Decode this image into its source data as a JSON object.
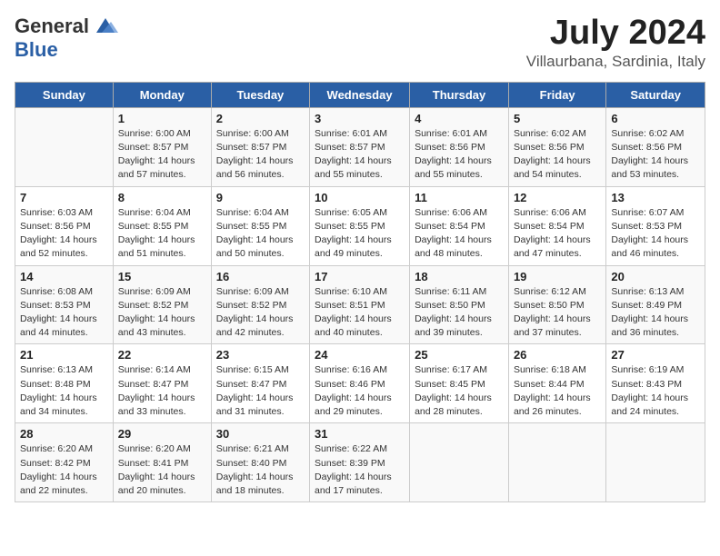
{
  "logo": {
    "general": "General",
    "blue": "Blue"
  },
  "title": "July 2024",
  "subtitle": "Villaurbana, Sardinia, Italy",
  "days_of_week": [
    "Sunday",
    "Monday",
    "Tuesday",
    "Wednesday",
    "Thursday",
    "Friday",
    "Saturday"
  ],
  "weeks": [
    [
      {
        "day": "",
        "info": ""
      },
      {
        "day": "1",
        "info": "Sunrise: 6:00 AM\nSunset: 8:57 PM\nDaylight: 14 hours\nand 57 minutes."
      },
      {
        "day": "2",
        "info": "Sunrise: 6:00 AM\nSunset: 8:57 PM\nDaylight: 14 hours\nand 56 minutes."
      },
      {
        "day": "3",
        "info": "Sunrise: 6:01 AM\nSunset: 8:57 PM\nDaylight: 14 hours\nand 55 minutes."
      },
      {
        "day": "4",
        "info": "Sunrise: 6:01 AM\nSunset: 8:56 PM\nDaylight: 14 hours\nand 55 minutes."
      },
      {
        "day": "5",
        "info": "Sunrise: 6:02 AM\nSunset: 8:56 PM\nDaylight: 14 hours\nand 54 minutes."
      },
      {
        "day": "6",
        "info": "Sunrise: 6:02 AM\nSunset: 8:56 PM\nDaylight: 14 hours\nand 53 minutes."
      }
    ],
    [
      {
        "day": "7",
        "info": "Sunrise: 6:03 AM\nSunset: 8:56 PM\nDaylight: 14 hours\nand 52 minutes."
      },
      {
        "day": "8",
        "info": "Sunrise: 6:04 AM\nSunset: 8:55 PM\nDaylight: 14 hours\nand 51 minutes."
      },
      {
        "day": "9",
        "info": "Sunrise: 6:04 AM\nSunset: 8:55 PM\nDaylight: 14 hours\nand 50 minutes."
      },
      {
        "day": "10",
        "info": "Sunrise: 6:05 AM\nSunset: 8:55 PM\nDaylight: 14 hours\nand 49 minutes."
      },
      {
        "day": "11",
        "info": "Sunrise: 6:06 AM\nSunset: 8:54 PM\nDaylight: 14 hours\nand 48 minutes."
      },
      {
        "day": "12",
        "info": "Sunrise: 6:06 AM\nSunset: 8:54 PM\nDaylight: 14 hours\nand 47 minutes."
      },
      {
        "day": "13",
        "info": "Sunrise: 6:07 AM\nSunset: 8:53 PM\nDaylight: 14 hours\nand 46 minutes."
      }
    ],
    [
      {
        "day": "14",
        "info": "Sunrise: 6:08 AM\nSunset: 8:53 PM\nDaylight: 14 hours\nand 44 minutes."
      },
      {
        "day": "15",
        "info": "Sunrise: 6:09 AM\nSunset: 8:52 PM\nDaylight: 14 hours\nand 43 minutes."
      },
      {
        "day": "16",
        "info": "Sunrise: 6:09 AM\nSunset: 8:52 PM\nDaylight: 14 hours\nand 42 minutes."
      },
      {
        "day": "17",
        "info": "Sunrise: 6:10 AM\nSunset: 8:51 PM\nDaylight: 14 hours\nand 40 minutes."
      },
      {
        "day": "18",
        "info": "Sunrise: 6:11 AM\nSunset: 8:50 PM\nDaylight: 14 hours\nand 39 minutes."
      },
      {
        "day": "19",
        "info": "Sunrise: 6:12 AM\nSunset: 8:50 PM\nDaylight: 14 hours\nand 37 minutes."
      },
      {
        "day": "20",
        "info": "Sunrise: 6:13 AM\nSunset: 8:49 PM\nDaylight: 14 hours\nand 36 minutes."
      }
    ],
    [
      {
        "day": "21",
        "info": "Sunrise: 6:13 AM\nSunset: 8:48 PM\nDaylight: 14 hours\nand 34 minutes."
      },
      {
        "day": "22",
        "info": "Sunrise: 6:14 AM\nSunset: 8:47 PM\nDaylight: 14 hours\nand 33 minutes."
      },
      {
        "day": "23",
        "info": "Sunrise: 6:15 AM\nSunset: 8:47 PM\nDaylight: 14 hours\nand 31 minutes."
      },
      {
        "day": "24",
        "info": "Sunrise: 6:16 AM\nSunset: 8:46 PM\nDaylight: 14 hours\nand 29 minutes."
      },
      {
        "day": "25",
        "info": "Sunrise: 6:17 AM\nSunset: 8:45 PM\nDaylight: 14 hours\nand 28 minutes."
      },
      {
        "day": "26",
        "info": "Sunrise: 6:18 AM\nSunset: 8:44 PM\nDaylight: 14 hours\nand 26 minutes."
      },
      {
        "day": "27",
        "info": "Sunrise: 6:19 AM\nSunset: 8:43 PM\nDaylight: 14 hours\nand 24 minutes."
      }
    ],
    [
      {
        "day": "28",
        "info": "Sunrise: 6:20 AM\nSunset: 8:42 PM\nDaylight: 14 hours\nand 22 minutes."
      },
      {
        "day": "29",
        "info": "Sunrise: 6:20 AM\nSunset: 8:41 PM\nDaylight: 14 hours\nand 20 minutes."
      },
      {
        "day": "30",
        "info": "Sunrise: 6:21 AM\nSunset: 8:40 PM\nDaylight: 14 hours\nand 18 minutes."
      },
      {
        "day": "31",
        "info": "Sunrise: 6:22 AM\nSunset: 8:39 PM\nDaylight: 14 hours\nand 17 minutes."
      },
      {
        "day": "",
        "info": ""
      },
      {
        "day": "",
        "info": ""
      },
      {
        "day": "",
        "info": ""
      }
    ]
  ]
}
